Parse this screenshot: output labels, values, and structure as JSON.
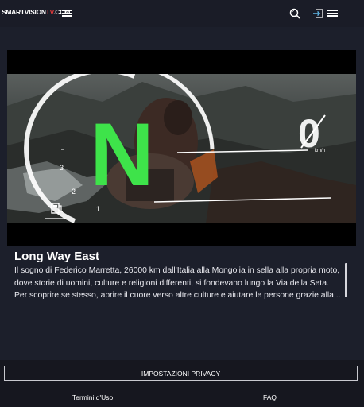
{
  "header": {
    "logo_main": "SMARTVISION",
    "logo_accent": "TV",
    "logo_suffix": ".COM"
  },
  "video": {
    "hud_gear": "N",
    "hud_speed": "0",
    "hud_speed_unit": "km/h",
    "hud_ticks": [
      "1",
      "2",
      "3"
    ]
  },
  "content": {
    "title": "Long Way East",
    "description": "Il sogno di Federico Marretta, 26000 km dall'Italia alla Mongolia in sella alla propria moto, dove storie di uomini, culture e religioni differenti, si fondevano lungo la Via della Seta. Per scoprire se stesso, aprire il cuore verso altre culture e aiutare le persone grazie alla..."
  },
  "footer": {
    "privacy_label": "IMPOSTAZIONI PRIVACY",
    "terms_label": "Termini d'Uso",
    "faq_label": "FAQ"
  },
  "colors": {
    "background": "#1c1f2b",
    "header": "#1a1c27",
    "footer": "#16171f",
    "hud_green": "#3ee34a",
    "logo_accent": "#e23a3a"
  },
  "icons": [
    "menu-icon",
    "search-icon",
    "login-icon",
    "menu-icon",
    "fuel-icon"
  ]
}
